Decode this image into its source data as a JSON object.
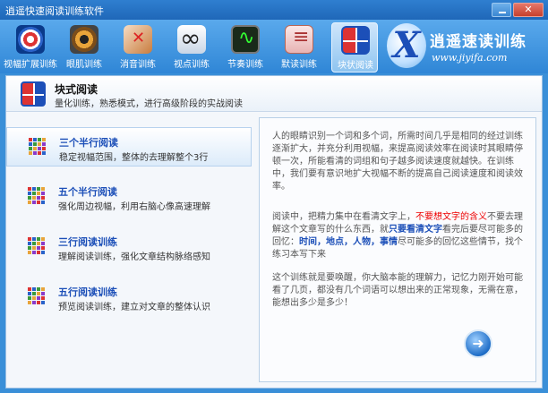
{
  "window": {
    "title": "逍遥快速阅读训练软件",
    "close_label": "✕"
  },
  "toolbar": {
    "items": [
      {
        "label": "视幅扩展训练",
        "icon": "target-icon"
      },
      {
        "label": "眼肌训练",
        "icon": "eye-icon"
      },
      {
        "label": "消音训练",
        "icon": "mute-icon"
      },
      {
        "label": "视点训练",
        "icon": "glasses-icon"
      },
      {
        "label": "节奏训练",
        "icon": "wave-icon"
      },
      {
        "label": "默读训练",
        "icon": "document-icon"
      },
      {
        "label": "块状阅读",
        "icon": "grid-icon",
        "active": true
      }
    ]
  },
  "logo": {
    "mark": "X",
    "name": "逍遥速读训练",
    "url": "www.jiyifa.com"
  },
  "header": {
    "title": "块式阅读",
    "subtitle": "量化训练，熟悉模式，进行高级阶段的实战阅读"
  },
  "list": {
    "items": [
      {
        "title": "三个半行阅读",
        "desc": "稳定视幅范围，整体的去理解整个3行",
        "active": true
      },
      {
        "title": "五个半行阅读",
        "desc": "强化周边视幅，利用右脑心像高速理解",
        "active": false
      },
      {
        "title": "三行阅读训练",
        "desc": "理解阅读训练，强化文章结构脉络感知",
        "active": false
      },
      {
        "title": "五行阅读训练",
        "desc": "预览阅读训练，建立对文章的整体认识",
        "active": false
      }
    ]
  },
  "panel": {
    "p1": "人的眼睛识别一个词和多个词，所需时间几乎是相同的经过训练逐渐扩大，并充分利用视幅，来提高阅读效率在阅读时其眼睛停顿一次，所能看清的词组和句子越多阅读速度就越快。在训练中，我们要有意识地扩大视幅不断的提高自己阅读速度和阅读效率。",
    "p2_a": "阅读中，把精力集中在看清文字上，",
    "p2_red": "不要想文字的含义",
    "p2_b": "不要去理解这个文章写的什么东西，就",
    "p2_blue1": "只要看清文字",
    "p2_c": "看完后要尽可能多的回忆：",
    "p2_blue2": "时间，地点，人物，事情",
    "p2_d": "尽可能多的回忆这些情节，找个练习本写下来",
    "p3": "这个训练就是要唤醒，你大脑本能的理解力，记忆力刚开始可能看了几页，都没有几个词语可以想出来的正常现象，无需在意，能想出多少是多少！",
    "next_glyph": "➜"
  },
  "colors": {
    "accent": "#1c4fb8",
    "highlight_red": "#e00000"
  }
}
